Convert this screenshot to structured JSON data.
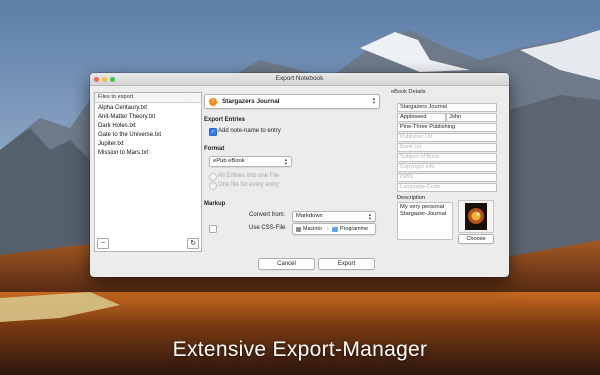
{
  "window": {
    "title": "Export Notebook"
  },
  "files_panel": {
    "header": "Files to export",
    "items": [
      "Alpha Centaury.txt",
      "Anit-Matter Theory.txt",
      "Dark Holes.txt",
      "Gate to the Universe.txt",
      "Jupiter.txt",
      "Mission to Mars.txt"
    ],
    "remove_label": "−",
    "refresh_label": "↻"
  },
  "notebook": {
    "selected": "Stargazers Journal"
  },
  "export_entries": {
    "heading": "Export Entries",
    "add_note_name_label": "Add note-name to entry",
    "add_note_name_checked": true
  },
  "format": {
    "heading": "Format",
    "selected": "ePub eBook",
    "options": [
      "All Entries into one File",
      "One file for every entry"
    ]
  },
  "markup": {
    "heading": "Markup",
    "convert_from_label": "Convert from:",
    "convert_from_value": "Markdown",
    "use_css_label": "Use CSS-File",
    "css_path": [
      "Macinto",
      "Programme"
    ]
  },
  "buttons": {
    "cancel": "Cancel",
    "export": "Export"
  },
  "ebook": {
    "heading": "eBook Details",
    "title": "Stargazers Journal",
    "author_last": "Appleseed",
    "author_first": "John",
    "publisher": "Pine-Three Publishing",
    "placeholders": {
      "publisher_url": "Publisher Url",
      "book_url": "Book Url",
      "subject": "Subject of Book",
      "copyright": "Copyright info",
      "isbn": "ISBN",
      "language": "Language-Code"
    },
    "description_label": "Description",
    "description": "My very personal Stargazer-Journal",
    "choose_label": "Choose"
  },
  "caption": "Extensive Export-Manager",
  "colors": {
    "accent": "#2f7cf6",
    "traffic_red": "#fc605c",
    "traffic_yellow": "#fdbc40",
    "traffic_green": "#34c84a",
    "notebook_icon": "#f08a12"
  }
}
